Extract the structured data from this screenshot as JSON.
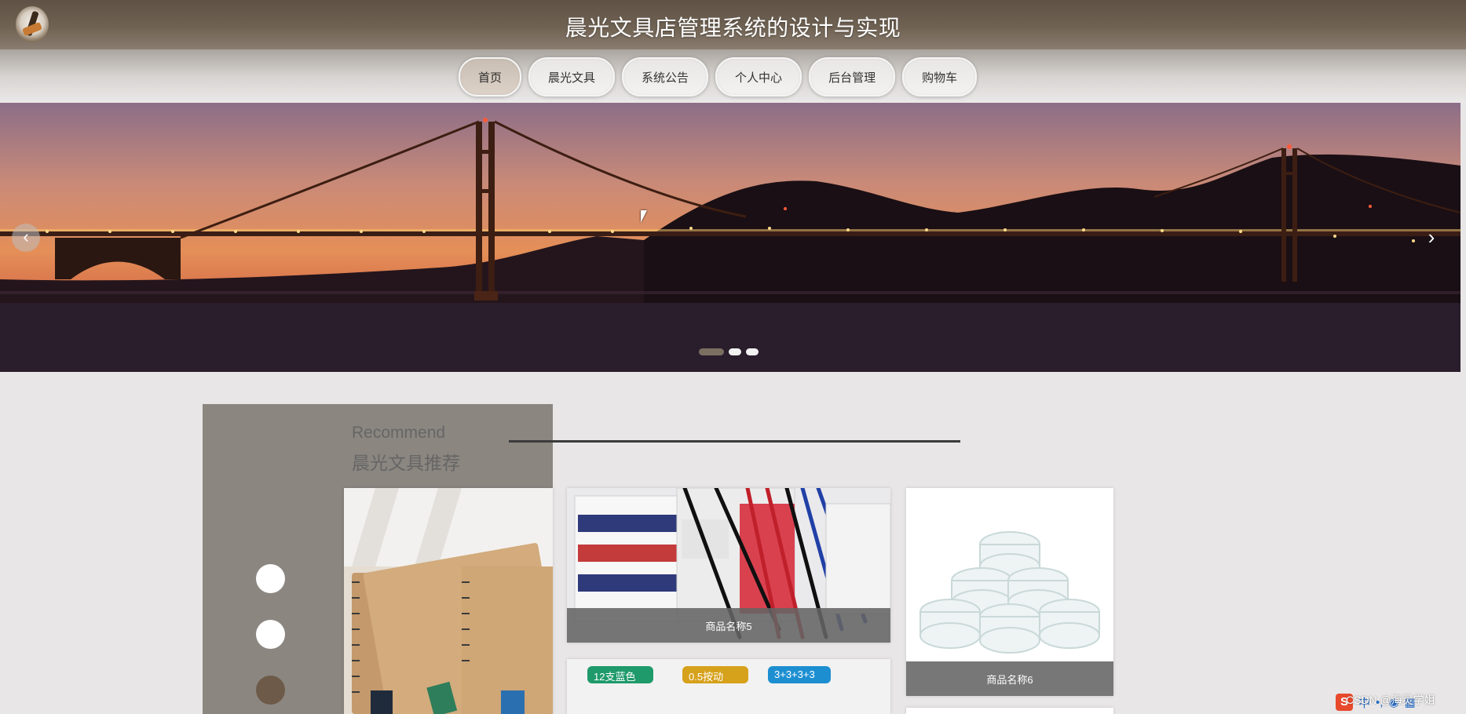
{
  "header": {
    "title": "晨光文具店管理系统的设计与实现"
  },
  "nav": {
    "items": [
      {
        "label": "首页",
        "active": true
      },
      {
        "label": "晨光文具",
        "active": false
      },
      {
        "label": "系统公告",
        "active": false
      },
      {
        "label": "个人中心",
        "active": false
      },
      {
        "label": "后台管理",
        "active": false
      },
      {
        "label": "购物车",
        "active": false
      }
    ]
  },
  "carousel": {
    "prev_icon": "‹",
    "next_icon": "›",
    "slide_count": 3,
    "active_slide": 1
  },
  "recommend": {
    "title_en": "Recommend",
    "title_cn": "晨光文具推荐",
    "selector_count": 3,
    "products": [
      {
        "name": "",
        "image": "notebooks"
      },
      {
        "name": "商品名称5",
        "image": "pens-box"
      },
      {
        "name": "商品名称6",
        "image": "tape-rolls"
      },
      {
        "name": "",
        "image": "gel-pens"
      }
    ],
    "tags": [
      "12支蓝色",
      "0.5按动",
      "3+3+3+3"
    ]
  },
  "overlay": {
    "watermark": "CSDN @海灵学姐"
  },
  "colors": {
    "header_bg": "#6a5d4f",
    "panel_bg": "#8b8680",
    "active_nav": "#d3c8bd",
    "caption_bg": "#646464"
  }
}
